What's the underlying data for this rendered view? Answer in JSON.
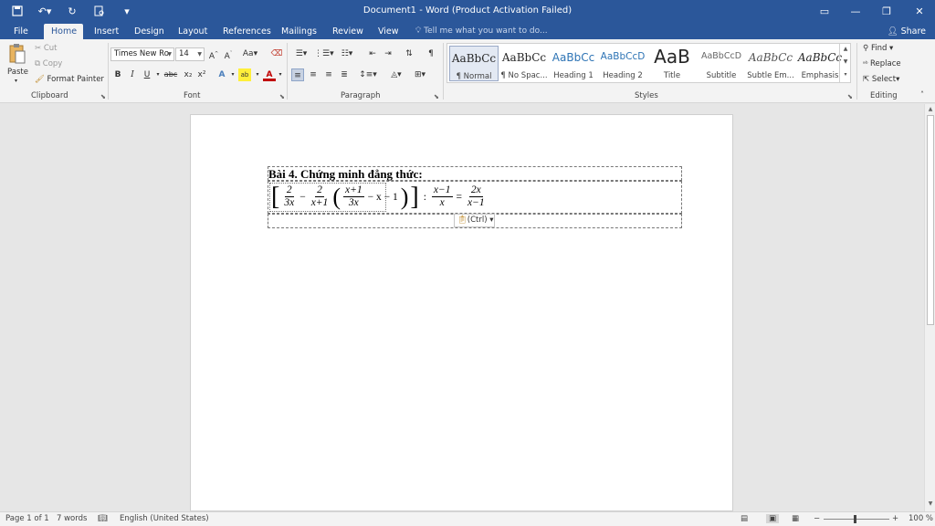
{
  "window": {
    "title": "Document1 - Word (Product Activation Failed)"
  },
  "quick_access": {
    "save_icon": "save-icon",
    "undo_icon": "undo-icon",
    "redo_icon": "redo-icon",
    "print_preview_icon": "print-preview-icon",
    "customize_icon": "customize-qat-icon"
  },
  "tabs": [
    {
      "label": "File"
    },
    {
      "label": "Home"
    },
    {
      "label": "Insert"
    },
    {
      "label": "Design"
    },
    {
      "label": "Layout"
    },
    {
      "label": "References"
    },
    {
      "label": "Mailings"
    },
    {
      "label": "Review"
    },
    {
      "label": "View"
    }
  ],
  "tell_me": {
    "placeholder": "Tell me what you want to do..."
  },
  "share": {
    "label": "Share"
  },
  "clipboard": {
    "paste": "Paste",
    "cut": "Cut",
    "copy": "Copy",
    "format_painter": "Format Painter",
    "group_label": "Clipboard"
  },
  "font": {
    "family": "Times New Ro",
    "size": "14",
    "change_case": "Aa",
    "bold": "B",
    "italic": "I",
    "underline": "U",
    "strikethrough": "abc",
    "subscript": "x₂",
    "superscript": "x²",
    "group_label": "Font"
  },
  "paragraph": {
    "group_label": "Paragraph"
  },
  "styles": {
    "items": [
      {
        "preview": "AaBbCc",
        "name": "¶ Normal"
      },
      {
        "preview": "AaBbCc",
        "name": "¶ No Spac..."
      },
      {
        "preview": "AaBbCc",
        "name": "Heading 1"
      },
      {
        "preview": "AaBbCcD",
        "name": "Heading 2"
      },
      {
        "preview": "AaB",
        "name": "Title"
      },
      {
        "preview": "AaBbCcD",
        "name": "Subtitle"
      },
      {
        "preview": "AaBbCc",
        "name": "Subtle Em..."
      },
      {
        "preview": "AaBbCc",
        "name": "Emphasis"
      }
    ],
    "group_label": "Styles"
  },
  "editing": {
    "find": "Find",
    "replace": "Replace",
    "select": "Select",
    "group_label": "Editing"
  },
  "document": {
    "heading": "Bài 4. Chứng minh đẳng thức:",
    "equation": {
      "f1_num": "2",
      "f1_den": "3x",
      "minus1": "−",
      "f2_num": "2",
      "f2_den": "x+1",
      "f3_num": "x+1",
      "f3_den": "3x",
      "tail": "− x − 1",
      "colon": ":",
      "f4_num": "x−1",
      "f4_den": "x",
      "equals": "=",
      "f5_num": "2x",
      "f5_den": "x−1"
    },
    "paste_options": "(Ctrl)"
  },
  "status": {
    "page": "Page 1 of 1",
    "words": "7 words",
    "language": "English (United States)",
    "zoom": "100 %",
    "zoom_minus": "−",
    "zoom_plus": "+"
  }
}
